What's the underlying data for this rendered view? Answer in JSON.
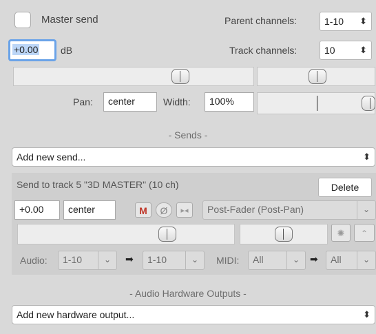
{
  "master": {
    "master_send_label": "Master send",
    "master_send_checked": false,
    "parent_channels_label": "Parent channels:",
    "parent_channels_value": "1-10",
    "volume_value": "+0.00",
    "volume_unit": "dB",
    "track_channels_label": "Track channels:",
    "track_channels_value": "10",
    "pan_label": "Pan:",
    "pan_value": "center",
    "width_label": "Width:",
    "width_value": "100%"
  },
  "sends": {
    "section_title": "- Sends -",
    "add_new_send": "Add new send...",
    "send": {
      "title": "Send to track 5 \"3D MASTER\" (10 ch)",
      "delete_label": "Delete",
      "volume_value": "+0.00",
      "pan_value": "center",
      "mute_label": "M",
      "phase_label": "Ø",
      "mode_value": "Post-Fader (Post-Pan)",
      "audio_label": "Audio:",
      "audio_source": "1-10",
      "audio_dest": "1-10",
      "midi_label": "MIDI:",
      "midi_source": "All",
      "midi_dest": "All",
      "arrow": "➡"
    }
  },
  "hardware": {
    "section_title": "- Audio Hardware Outputs -",
    "add_new_output": "Add new hardware output..."
  },
  "icons": {
    "updown_chevron": "⌃⌄",
    "down_chevron": "⌄"
  },
  "colors": {
    "focus_ring": "#6aa3e8",
    "mute_red": "#c0392b",
    "background": "#d9d9d9"
  }
}
